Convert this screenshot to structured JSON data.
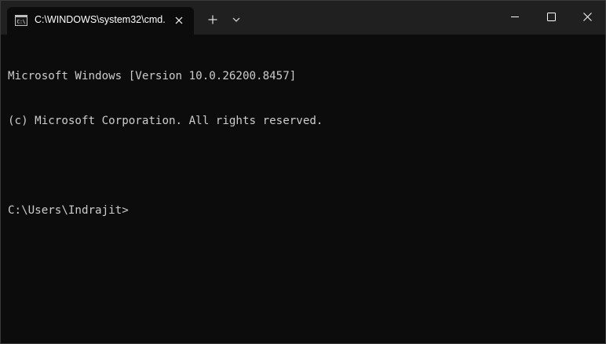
{
  "tab": {
    "title": "C:\\WINDOWS\\system32\\cmd.",
    "icon": "cmd-icon"
  },
  "titlebar": {
    "new_tab_icon": "plus-icon",
    "dropdown_icon": "chevron-down-icon",
    "minimize_icon": "minimize-icon",
    "maximize_icon": "maximize-icon",
    "close_icon": "close-icon"
  },
  "terminal": {
    "lines": [
      "Microsoft Windows [Version 10.0.26200.8457]",
      "(c) Microsoft Corporation. All rights reserved.",
      "",
      "C:\\Users\\Indrajit>"
    ]
  },
  "colors": {
    "background": "#0c0c0c",
    "titlebar": "#202020",
    "text": "#cccccc"
  }
}
